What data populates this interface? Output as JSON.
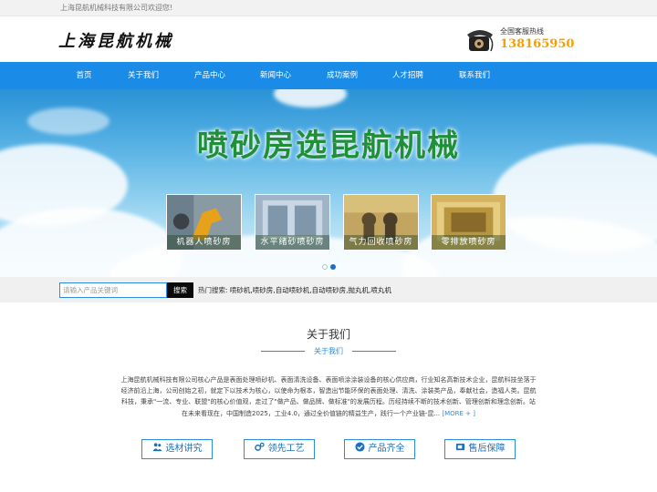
{
  "topbar": {
    "welcome": "上海昆航机械科技有限公司欢迎您!"
  },
  "header": {
    "logo": "上海昆航机械",
    "hotline_label": "全国客服热线",
    "hotline_number": "138165950",
    "phone_icon": "telephone-icon"
  },
  "nav": {
    "items": [
      {
        "label": "首页"
      },
      {
        "label": "关于我们"
      },
      {
        "label": "产品中心"
      },
      {
        "label": "新闻中心"
      },
      {
        "label": "成功案例"
      },
      {
        "label": "人才招聘"
      },
      {
        "label": "联系我们"
      }
    ]
  },
  "banner": {
    "title": "喷砂房选昆航机械",
    "products": [
      {
        "caption": "机器人喷砂房"
      },
      {
        "caption": "水平绪砂喷砂房"
      },
      {
        "caption": "气力回收喷砂房"
      },
      {
        "caption": "零排放喷砂房"
      }
    ],
    "slide_count": 2,
    "active_slide": 2
  },
  "search": {
    "placeholder": "请输入产品关键词",
    "button_label": "搜索",
    "hot_label": "热门搜索:",
    "hot_terms": "喷砂机,喷砂房,自动喷砂机,自动喷砂房,抛丸机,喷丸机"
  },
  "about": {
    "title": "关于我们",
    "subtitle": "关于我们",
    "text": "上海昆航机械科技有限公司核心产品是表面处理喷砂机、表面清洗设备、表面喷涂涂装设备的核心供应商，行业知名高新技术企业，昆航科技坐落于经济前沿上海，公司创始之初，就定下以技术为核心，以使命为根本，智造出节能环保的表面处理、清洗、涂装类产品，奉献社会，造福人类。昆航科技，秉承\"一流、专业、联盟\"的核心价值观，走过了\"做产品、做品牌、做标准\"的发展历程。历经持续不断的技术创新、管理创新和理念创新。站在未来看现在，中国制造2025，工业4.0，通过全价值链的精益生产，践行一个产业链-昆...",
    "more_label": "[MORE + ]"
  },
  "features": [
    {
      "label": "选材讲究",
      "icon": "users-icon"
    },
    {
      "label": "领先工艺",
      "icon": "gears-icon"
    },
    {
      "label": "产品齐全",
      "icon": "check-circle-icon"
    },
    {
      "label": "售后保障",
      "icon": "coffee-cup-icon"
    }
  ],
  "colors": {
    "accent": "#1a8be6",
    "hotline": "#f5a000",
    "banner_title": "#1f8f3a"
  }
}
